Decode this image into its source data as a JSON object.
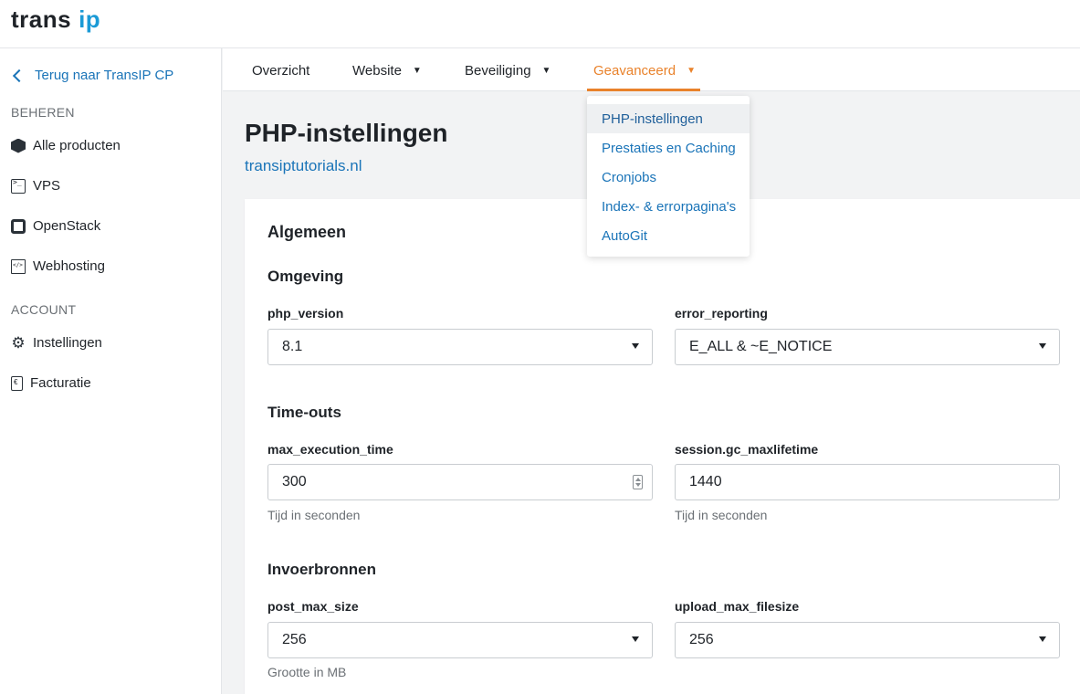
{
  "logo": {
    "part1": "trans",
    "part2": "ip"
  },
  "sidebar": {
    "back_label": "Terug naar TransIP CP",
    "section_beheren": "BEHEREN",
    "section_account": "ACCOUNT",
    "items": [
      {
        "label": "Alle producten",
        "icon": "cube-icon"
      },
      {
        "label": "VPS",
        "icon": "terminal-icon"
      },
      {
        "label": "OpenStack",
        "icon": "openstack-icon"
      },
      {
        "label": "Webhosting",
        "icon": "webhosting-icon"
      },
      {
        "label": "Instellingen",
        "icon": "gear-icon"
      },
      {
        "label": "Facturatie",
        "icon": "invoice-icon"
      }
    ]
  },
  "tabs": [
    {
      "label": "Overzicht",
      "caret": ""
    },
    {
      "label": "Website",
      "caret": "▼"
    },
    {
      "label": "Beveiliging",
      "caret": "▼"
    },
    {
      "label": "Geavanceerd",
      "caret": "▼"
    }
  ],
  "dropdown": {
    "items": [
      "PHP-instellingen",
      "Prestaties en Caching",
      "Cronjobs",
      "Index- & errorpagina's",
      "AutoGit"
    ]
  },
  "page": {
    "title": "PHP-instellingen",
    "domain": "transiptutorials.nl"
  },
  "card": {
    "heading": "Algemeen",
    "sections": [
      {
        "title": "Omgeving"
      },
      {
        "title": "Time-outs"
      },
      {
        "title": "Invoerbronnen"
      }
    ],
    "fields": {
      "php_version": {
        "label": "php_version",
        "value": "8.1"
      },
      "error_reporting": {
        "label": "error_reporting",
        "value": "E_ALL & ~E_NOTICE"
      },
      "max_execution_time": {
        "label": "max_execution_time",
        "value": "300",
        "hint": "Tijd in seconden"
      },
      "session_gc": {
        "label": "session.gc_maxlifetime",
        "value": "1440",
        "hint": "Tijd in seconden"
      },
      "post_max_size": {
        "label": "post_max_size",
        "value": "256",
        "hint": "Grootte in MB"
      },
      "upload_max_filesize": {
        "label": "upload_max_filesize",
        "value": "256"
      }
    }
  }
}
